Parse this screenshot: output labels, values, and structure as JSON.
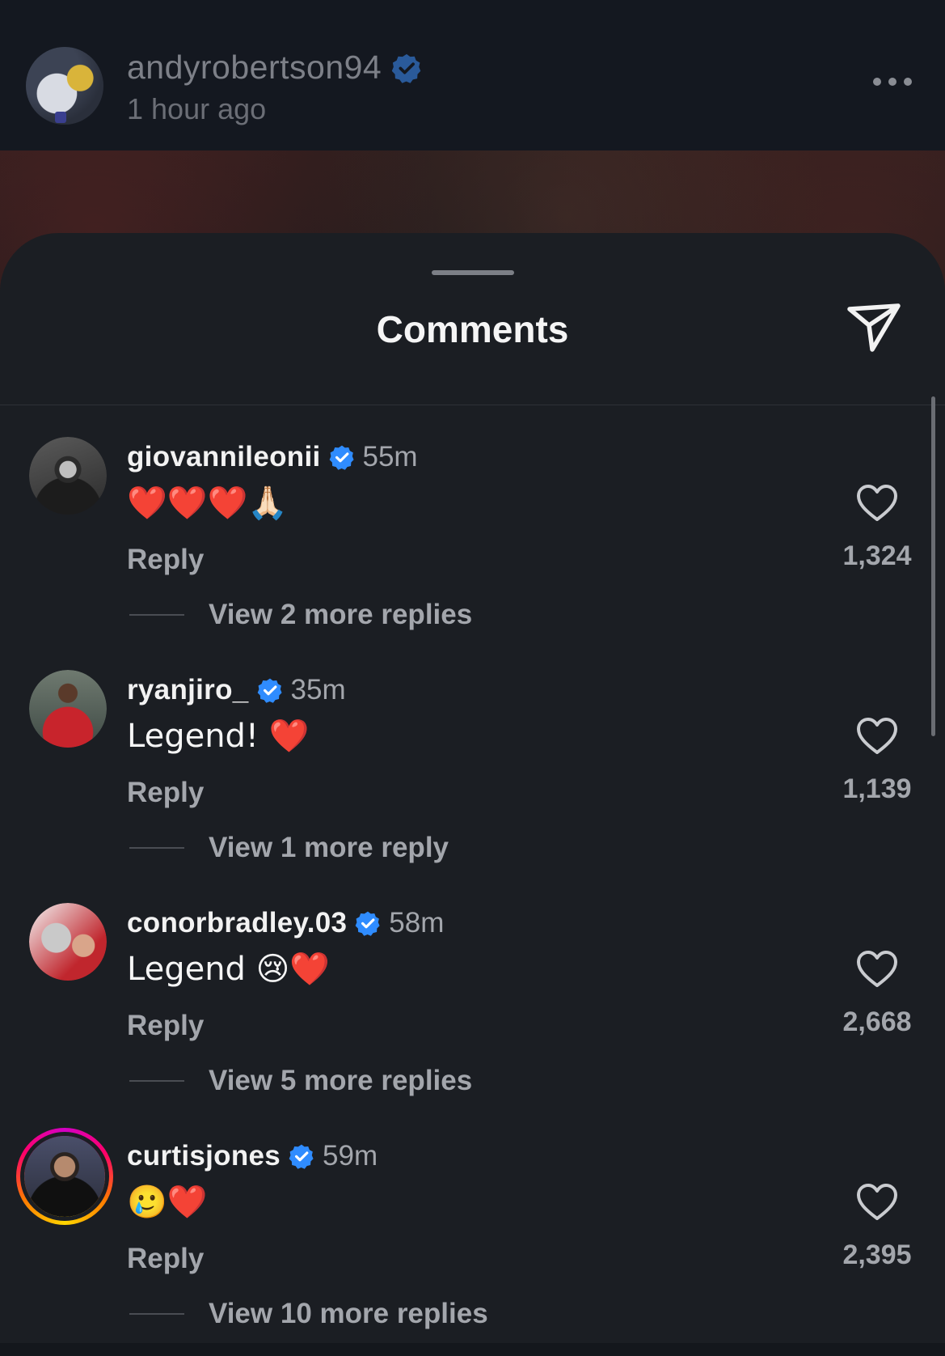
{
  "post": {
    "username": "andyrobertson94",
    "time": "1 hour ago",
    "verified": true
  },
  "sheet": {
    "title": "Comments"
  },
  "comments": [
    {
      "username": "giovannileonii",
      "time": "55m",
      "text": "❤️❤️❤️🙏🏻",
      "reply_label": "Reply",
      "view_replies": "View 2 more replies",
      "likes": "1,324",
      "avatar_icon": "dark-portrait"
    },
    {
      "username": "ryanjiro_",
      "time": "35m",
      "text": "Legend! ❤️",
      "reply_label": "Reply",
      "view_replies": "View 1 more reply",
      "likes": "1,139",
      "avatar_icon": "red-kit-portrait"
    },
    {
      "username": "conorbradley.03",
      "time": "58m",
      "text": "Legend 😢❤️",
      "reply_label": "Reply",
      "view_replies": "View 5 more replies",
      "likes": "2,668",
      "avatar_icon": "trophy-portrait"
    },
    {
      "username": "curtisjones",
      "time": "59m",
      "text": "🥲❤️",
      "reply_label": "Reply",
      "view_replies": "View 10 more replies",
      "likes": "2,395",
      "avatar_icon": "story-ring-portrait"
    }
  ],
  "colors": {
    "sheet_bg": "#1b1e23",
    "verified_blue": "#2f8cff",
    "muted_text": "#a3a6ac",
    "story_ring": "#ff0069"
  }
}
